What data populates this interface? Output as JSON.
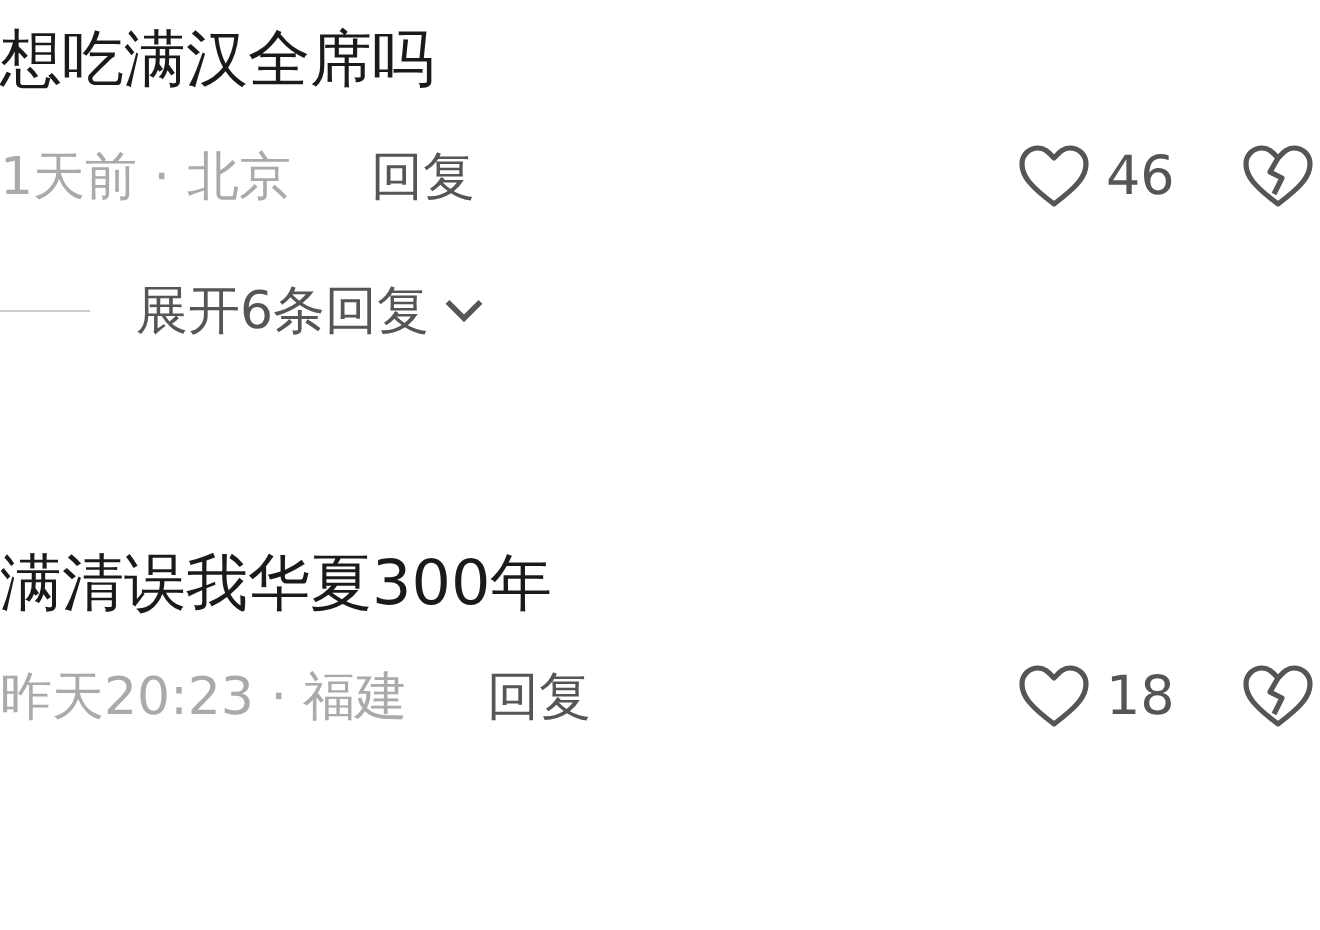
{
  "comments": [
    {
      "text": "想吃满汉全席吗",
      "meta": "1天前 · 北京",
      "reply": "回复",
      "likes": "46",
      "replies_toggle": "展开6条回复"
    },
    {
      "text": "满清误我华夏300年",
      "meta": "昨天20:23 · 福建",
      "reply": "回复",
      "likes": "18"
    }
  ]
}
